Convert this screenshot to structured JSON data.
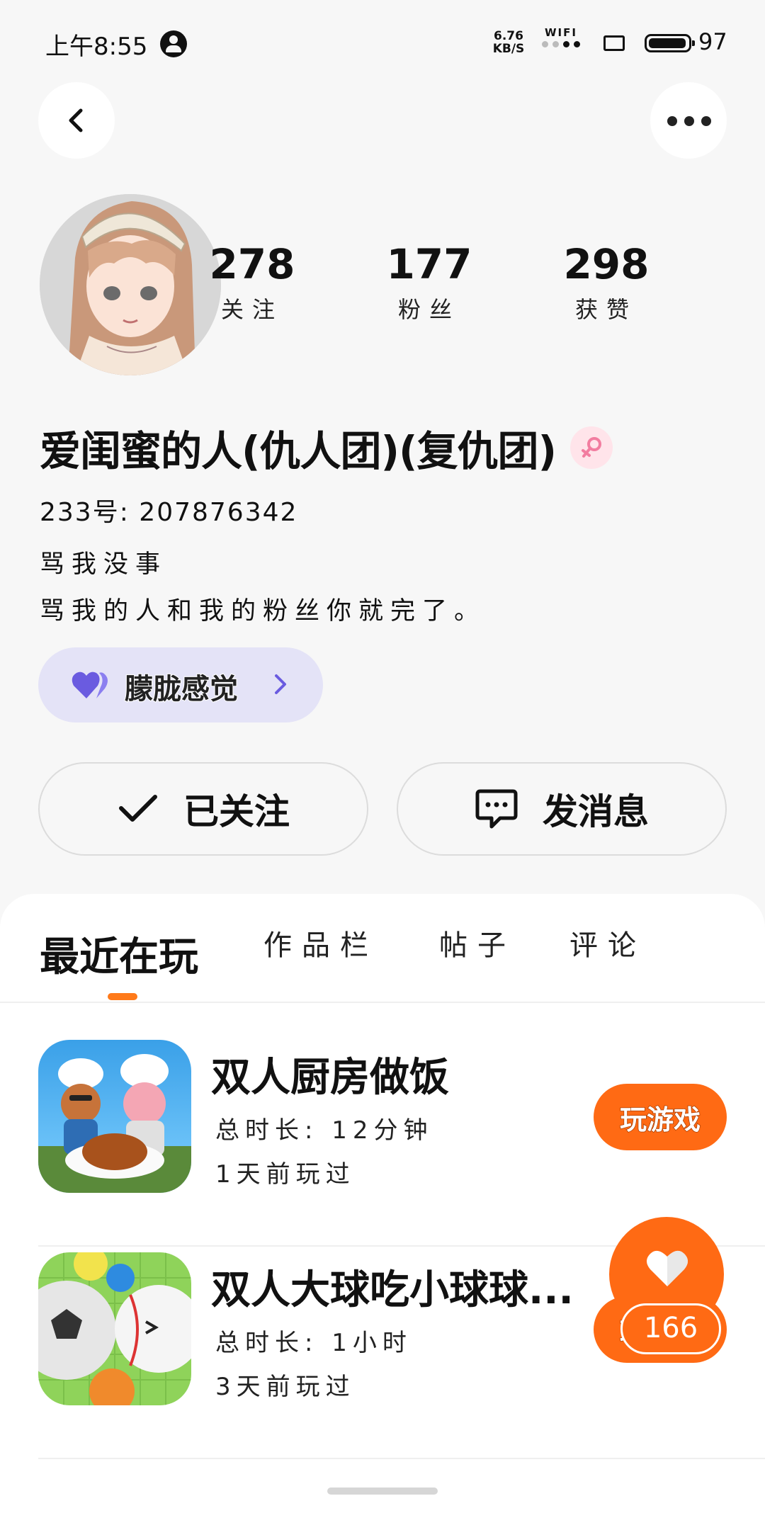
{
  "status_bar": {
    "time": "上午8:55",
    "net_speed_value": "6.76",
    "net_speed_unit": "KB/S",
    "wifi_label": "WIFI",
    "battery": "97",
    "battery_level": 0.97
  },
  "profile": {
    "stats": [
      {
        "value": "278",
        "label": "关注"
      },
      {
        "value": "177",
        "label": "粉丝"
      },
      {
        "value": "298",
        "label": "获赞"
      }
    ],
    "name": "爱闺蜜的人(仇人团)(复仇团)",
    "uid": "233号: 207876342",
    "bio_line1": "骂我没事",
    "bio_line2": "骂我的人和我的粉丝你就完了。",
    "tag": "朦胧感觉",
    "follow_label": "已关注",
    "message_label": "发消息"
  },
  "tabs": [
    {
      "label": "最近在玩"
    },
    {
      "label": "作品栏"
    },
    {
      "label": "帖子"
    },
    {
      "label": "评论"
    }
  ],
  "games": [
    {
      "title": "双人厨房做饭",
      "duration": "总时长: 12分钟",
      "last_played": "1天前玩过",
      "button": "玩游戏"
    },
    {
      "title": "双人大球吃小球球...",
      "duration": "总时长: 1小时",
      "last_played": "3天前玩过",
      "button": "玩游戏"
    }
  ],
  "fab": {
    "count": "166"
  },
  "colors": {
    "accent": "#ff6a14",
    "tag_bg": "#e4e3f7",
    "tag_heart": "#6a5be0"
  }
}
